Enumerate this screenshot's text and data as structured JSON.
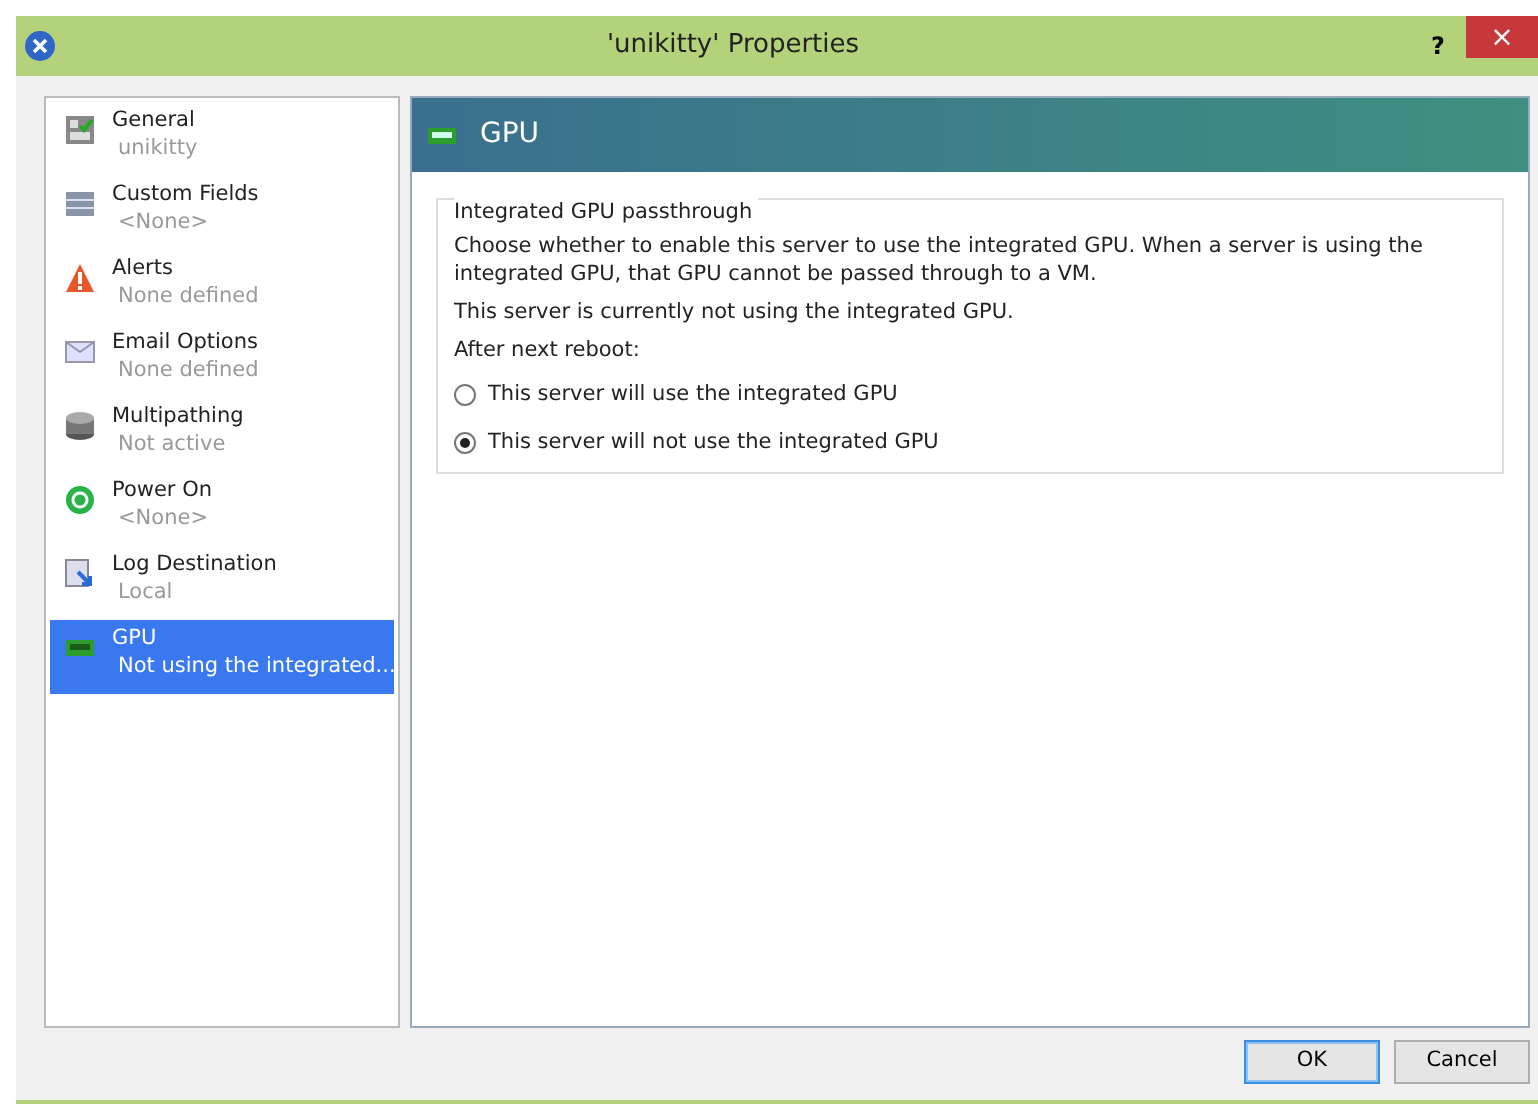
{
  "window": {
    "title": "'unikitty' Properties",
    "help": "?",
    "close": "×"
  },
  "sidebar": {
    "items": [
      {
        "label": "General",
        "sublabel": "unikitty",
        "selected": false
      },
      {
        "label": "Custom Fields",
        "sublabel": "<None>",
        "selected": false
      },
      {
        "label": "Alerts",
        "sublabel": "None defined",
        "selected": false
      },
      {
        "label": "Email Options",
        "sublabel": "None defined",
        "selected": false
      },
      {
        "label": "Multipathing",
        "sublabel": "Not active",
        "selected": false
      },
      {
        "label": "Power On",
        "sublabel": "<None>",
        "selected": false
      },
      {
        "label": "Log Destination",
        "sublabel": "Local",
        "selected": false
      },
      {
        "label": "GPU",
        "sublabel": "Not using the integrated...",
        "selected": true
      }
    ]
  },
  "panel": {
    "title": "GPU",
    "group": {
      "title": "Integrated GPU passthrough",
      "paragraphs": [
        "Choose whether to enable this server to use the integrated GPU. When a server is using the integrated GPU, that GPU cannot be passed through to a VM.",
        "This server is currently not using the integrated GPU.",
        "After next reboot:"
      ],
      "options": [
        {
          "label": "This server will use the integrated GPU",
          "selected": false
        },
        {
          "label": "This server will not use the integrated GPU",
          "selected": true
        }
      ]
    }
  },
  "buttons": [
    {
      "label": "OK",
      "default": true
    },
    {
      "label": "Cancel",
      "default": false
    }
  ]
}
